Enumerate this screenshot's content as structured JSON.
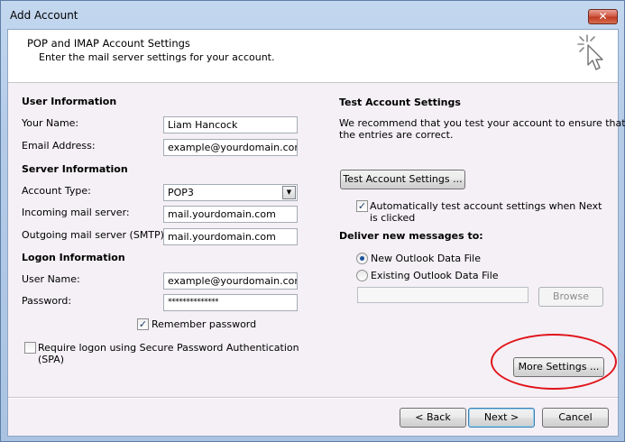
{
  "window": {
    "title": "Add Account",
    "close_glyph": "✕"
  },
  "header": {
    "title": "POP and IMAP Account Settings",
    "subtitle": "Enter the mail server settings for your account.",
    "icon": "cursor-sparkle-icon"
  },
  "user_info": {
    "heading": "User Information",
    "name_label": "Your Name:",
    "name_value": "Liam Hancock",
    "email_label": "Email Address:",
    "email_value": "example@yourdomain.com"
  },
  "server_info": {
    "heading": "Server Information",
    "account_type_label": "Account Type:",
    "account_type_value": "POP3",
    "incoming_label": "Incoming mail server:",
    "incoming_value": "mail.yourdomain.com",
    "outgoing_label": "Outgoing mail server (SMTP):",
    "outgoing_value": "mail.yourdomain.com"
  },
  "logon_info": {
    "heading": "Logon Information",
    "username_label": "User Name:",
    "username_value": "example@yourdomain.com",
    "password_label": "Password:",
    "password_value": "**************",
    "remember_label": "Remember password",
    "remember_checked": true,
    "spa_label_line1": "Require logon using Secure Password Authentication",
    "spa_label_line2": "(SPA)",
    "spa_checked": false
  },
  "test_settings": {
    "heading": "Test Account Settings",
    "desc_line1": "We recommend that you test your account to ensure that",
    "desc_line2": "the entries are correct.",
    "test_button": "Test Account Settings ...",
    "auto_test_line1": "Automatically test account settings when Next",
    "auto_test_line2": "is clicked",
    "auto_test_checked": true
  },
  "deliver": {
    "heading": "Deliver new messages to:",
    "option_new": "New Outlook Data File",
    "option_existing": "Existing Outlook Data File",
    "selected": "new",
    "existing_path": "",
    "browse_button": "Browse"
  },
  "more_settings_button": "More Settings ...",
  "footer": {
    "back_button": "< Back",
    "next_button": "Next >",
    "cancel_button": "Cancel"
  },
  "colors": {
    "highlight_oval": "#e0141b",
    "close_button": "#c13b25"
  }
}
